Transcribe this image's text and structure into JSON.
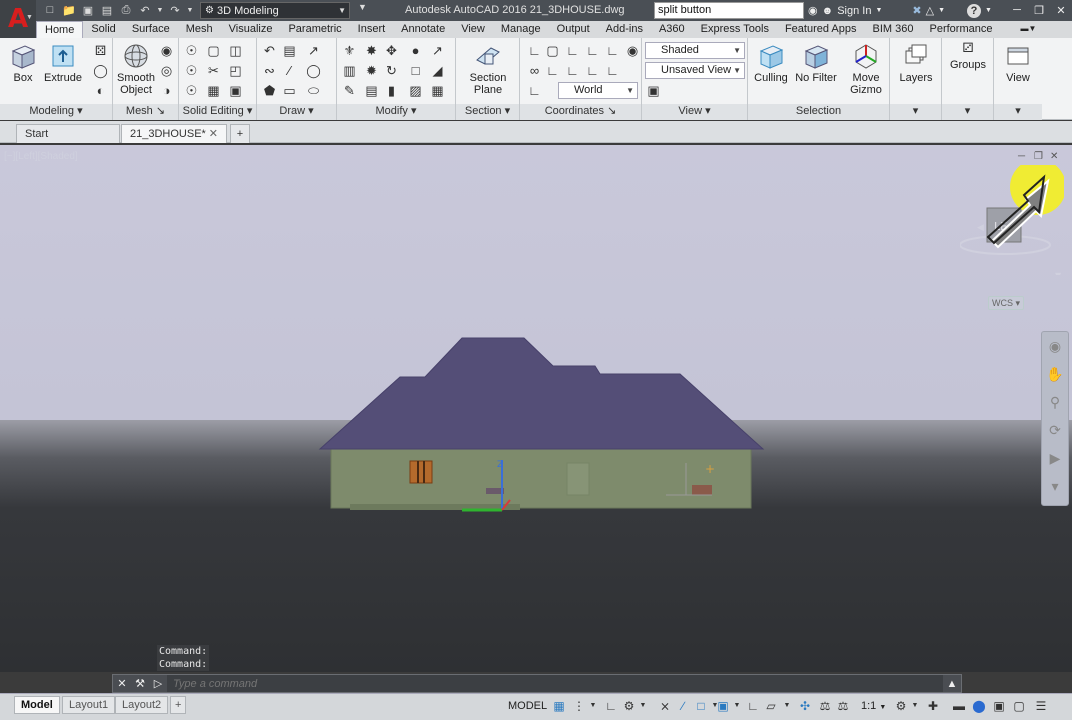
{
  "window": {
    "app_title": "Autodesk AutoCAD 2016   21_3DHOUSE.dwg",
    "workspace": "3D Modeling",
    "search_value": "split button",
    "sign_in": "Sign In"
  },
  "ribbon_tabs": [
    "Home",
    "Solid",
    "Surface",
    "Mesh",
    "Visualize",
    "Parametric",
    "Insert",
    "Annotate",
    "View",
    "Manage",
    "Output",
    "Add-ins",
    "A360",
    "Express Tools",
    "Featured Apps",
    "BIM 360",
    "Performance"
  ],
  "ribbon": {
    "modeling": {
      "title": "Modeling",
      "box": "Box",
      "extrude": "Extrude"
    },
    "mesh": {
      "title": "Mesh",
      "smooth_object": "Smooth\nObject"
    },
    "solid_editing": {
      "title": "Solid Editing"
    },
    "draw": {
      "title": "Draw"
    },
    "modify": {
      "title": "Modify"
    },
    "section": {
      "title": "Section",
      "section_plane": "Section\nPlane"
    },
    "coordinates": {
      "title": "Coordinates",
      "world": "World"
    },
    "view": {
      "title": "View",
      "visual_style": "Shaded",
      "named_view": "Unsaved View"
    },
    "selection": {
      "title": "Selection",
      "culling": "Culling",
      "no_filter": "No Filter",
      "move_gizmo": "Move\nGizmo"
    },
    "layers": {
      "label": "Layers"
    },
    "groups": {
      "label": "Groups"
    },
    "view_btn": {
      "label": "View"
    }
  },
  "doc_tabs": {
    "start": "Start",
    "active": "21_3DHOUSE*",
    "add": "+"
  },
  "viewport": {
    "label": "[−][Left][Shaded]",
    "wcs": "WCS",
    "colors": {
      "sky": "#c6c6d8",
      "ground": "#2e3033",
      "roof": "#544e77",
      "walls": "#7e8b6c"
    }
  },
  "command": {
    "history": [
      "Command:",
      "Command:"
    ],
    "placeholder": "Type a command"
  },
  "status": {
    "layout_tabs": [
      "Model",
      "Layout1",
      "Layout2"
    ],
    "add": "+",
    "model": "MODEL",
    "scale": "1:1"
  }
}
